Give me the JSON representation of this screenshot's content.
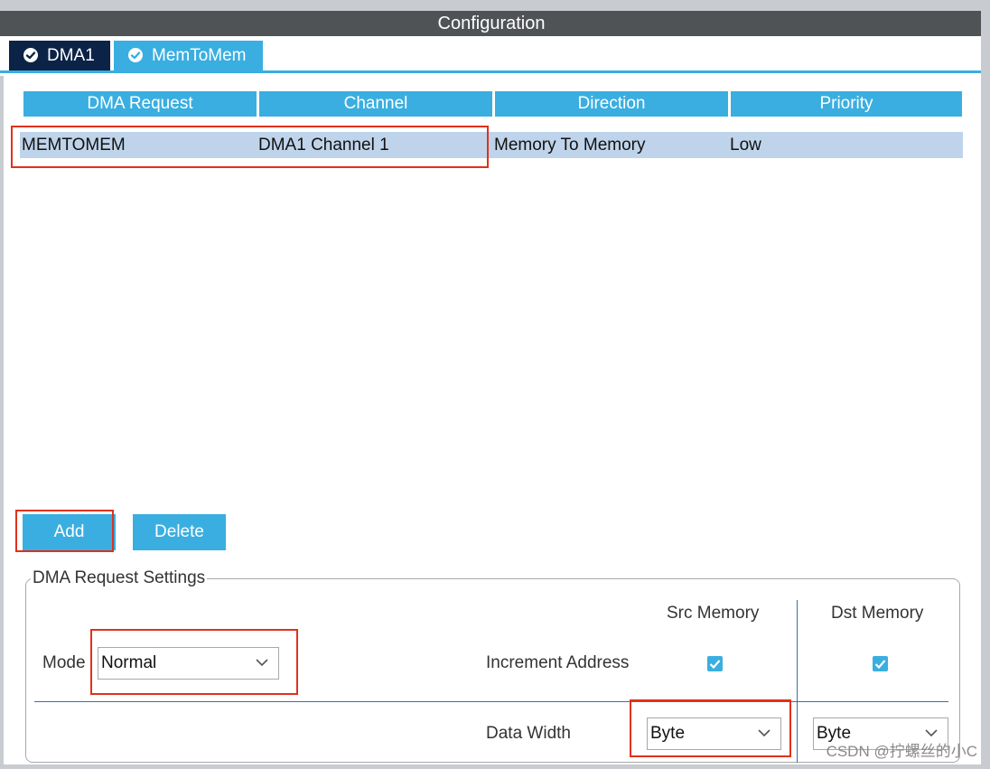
{
  "window": {
    "title": "Configuration"
  },
  "tabs": [
    {
      "label": "DMA1",
      "status_icon": "check-circle-icon"
    },
    {
      "label": "MemToMem",
      "status_icon": "check-circle-icon"
    }
  ],
  "table": {
    "headers": [
      "DMA Request",
      "Channel",
      "Direction",
      "Priority"
    ],
    "rows": [
      {
        "request": "MEMTOMEM",
        "channel": "DMA1 Channel 1",
        "direction": "Memory To Memory",
        "priority": "Low"
      }
    ]
  },
  "buttons": {
    "add": "Add",
    "delete": "Delete"
  },
  "settings": {
    "legend": "DMA Request Settings",
    "mode_label": "Mode",
    "mode_value": "Normal",
    "src_header": "Src Memory",
    "dst_header": "Dst Memory",
    "increment_label": "Increment Address",
    "src_increment_checked": true,
    "dst_increment_checked": true,
    "data_width_label": "Data Width",
    "src_data_width": "Byte",
    "dst_data_width": "Byte"
  },
  "watermark": "CSDN @拧螺丝的小C",
  "colors": {
    "accent": "#3aaee0",
    "tab_dark": "#0b2346",
    "title_bar": "#505356",
    "row_selected": "#bfd4ea",
    "highlight": "#e0311c"
  }
}
